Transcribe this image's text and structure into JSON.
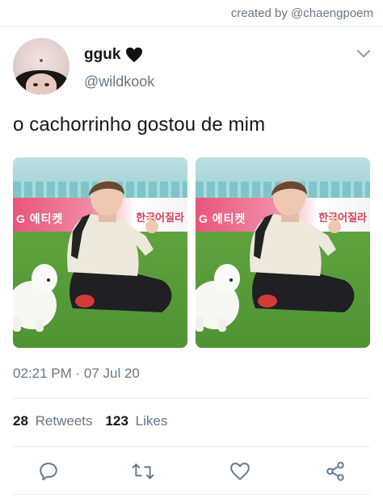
{
  "credit": "created by @chaengpoem",
  "tweet": {
    "display_name": "gguk",
    "handle": "@wildkook",
    "text": "o cachorrinho gostou de mim",
    "timestamp": "02:21 PM · 07 Jul 20",
    "retweets_count": "28",
    "retweets_label": "Retweets",
    "likes_count": "123",
    "likes_label": "Likes",
    "media": [
      {
        "banner_text": "한국어질라",
        "banner_left": "G 에티켓"
      },
      {
        "banner_text": "한국어질라",
        "banner_left": "G 에티켓"
      }
    ]
  },
  "icons": {
    "name_badge": "black-heart-icon",
    "menu": "chevron-down-icon",
    "reply": "reply-icon",
    "retweet": "retweet-icon",
    "like": "like-heart-icon",
    "share": "share-icon"
  },
  "colors": {
    "text_primary": "#14171a",
    "text_secondary": "#657786",
    "divider": "#e6ecf0",
    "icon": "#657786"
  }
}
